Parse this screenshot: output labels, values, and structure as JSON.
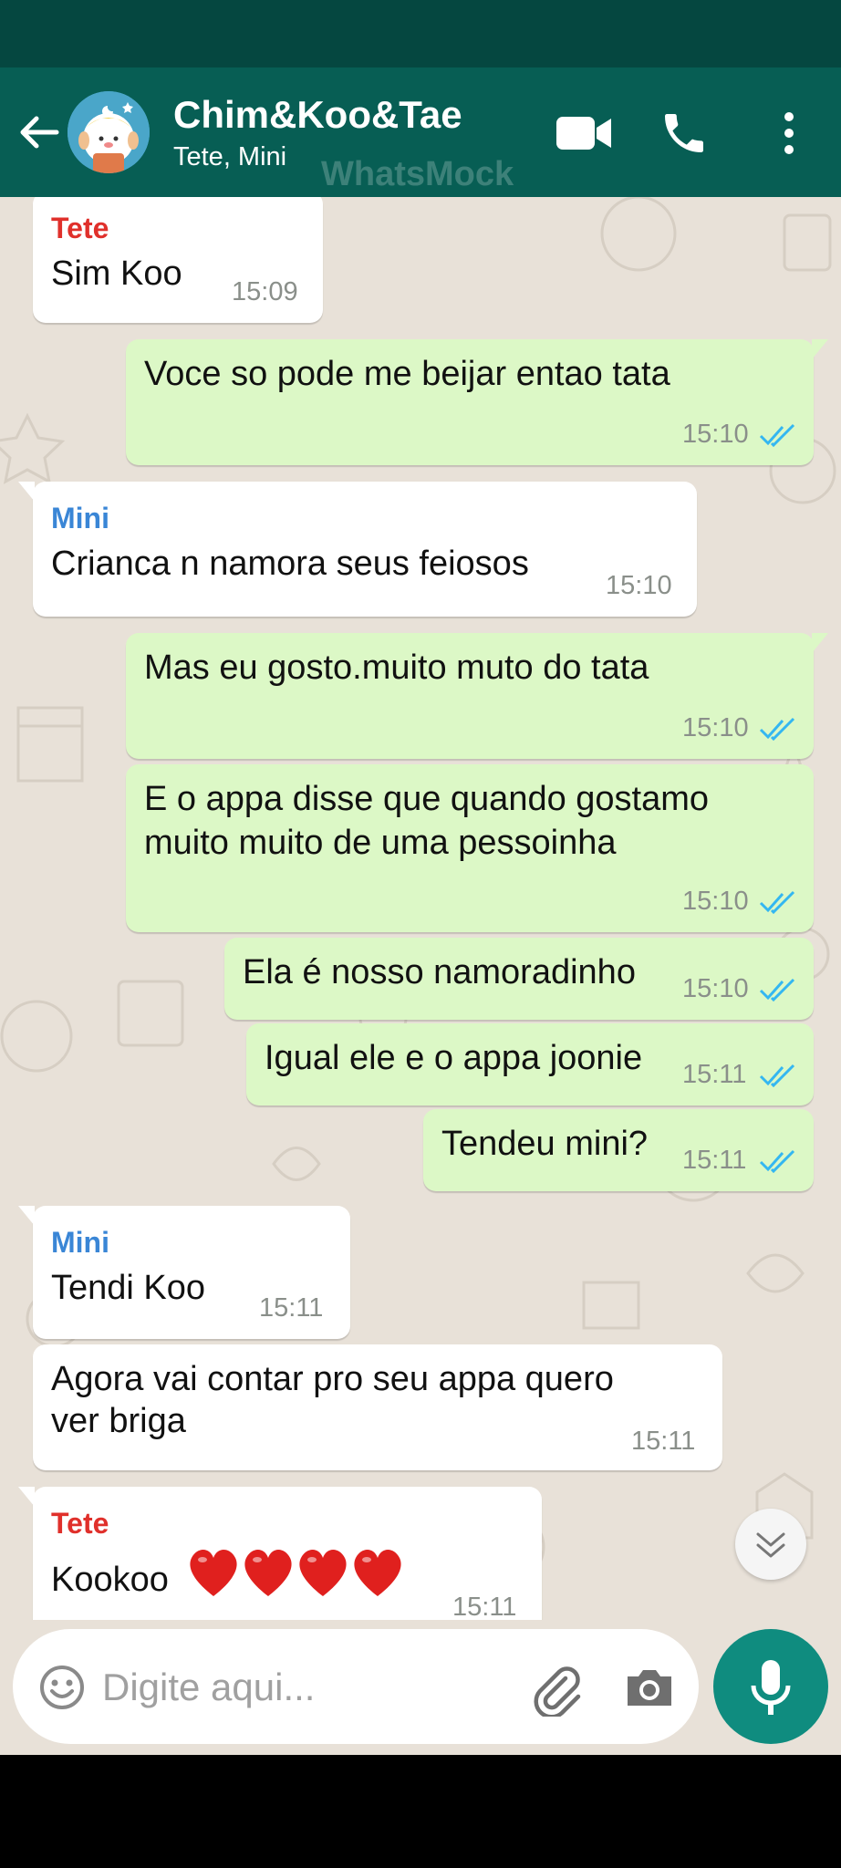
{
  "header": {
    "title": "Chim&Koo&Tae",
    "subtitle": "Tete, Mini",
    "watermark": "WhatsMock"
  },
  "icons": {
    "back": "arrow-left-icon",
    "video": "video-camera-icon",
    "call": "phone-icon",
    "more": "more-vertical-icon",
    "scroll": "chevron-double-down-icon",
    "emoji": "emoji-icon",
    "attach": "paperclip-icon",
    "camera": "camera-icon",
    "mic": "microphone-icon"
  },
  "colors": {
    "header": "#075e54",
    "status_bar": "#054740",
    "outgoing_bubble": "#dcf8c6",
    "incoming_bubble": "#ffffff",
    "chat_background": "#e8e1d8",
    "sender_tete": "#e0302b",
    "sender_mini": "#3a86d6",
    "read_ticks": "#34b7f1",
    "mic_button": "#0f8c7f"
  },
  "messages": [
    {
      "sender": "Tete",
      "text": "Sim Koo",
      "time": "15:09",
      "direction": "in"
    },
    {
      "text": "Voce so pode me beijar entao tata",
      "time": "15:10",
      "direction": "out",
      "status": "read"
    },
    {
      "sender": "Mini",
      "text": "Crianca n namora seus feiosos",
      "time": "15:10",
      "direction": "in"
    },
    {
      "text": "Mas eu gosto.muito muto do tata",
      "time": "15:10",
      "direction": "out",
      "status": "read"
    },
    {
      "text_line1": "E o appa disse que quando gostamo",
      "text_line2": "muito muito de uma pessoinha",
      "time": "15:10",
      "direction": "out",
      "status": "read"
    },
    {
      "text": "Ela é nosso namoradinho",
      "time": "15:10",
      "direction": "out",
      "status": "read"
    },
    {
      "text": "Igual ele e o appa joonie",
      "time": "15:11",
      "direction": "out",
      "status": "read"
    },
    {
      "text": "Tendeu mini?",
      "time": "15:11",
      "direction": "out",
      "status": "read"
    },
    {
      "sender": "Mini",
      "text": "Tendi Koo",
      "time": "15:11",
      "direction": "in"
    },
    {
      "text_line1": "Agora vai contar pro seu appa quero",
      "text_line2": "ver briga",
      "time": "15:11",
      "direction": "in"
    },
    {
      "sender": "Tete",
      "text": "Kookoo",
      "emoji": "❤️❤️❤️❤️",
      "time": "15:11",
      "direction": "in"
    }
  ],
  "input": {
    "placeholder": "Digite aqui..."
  }
}
